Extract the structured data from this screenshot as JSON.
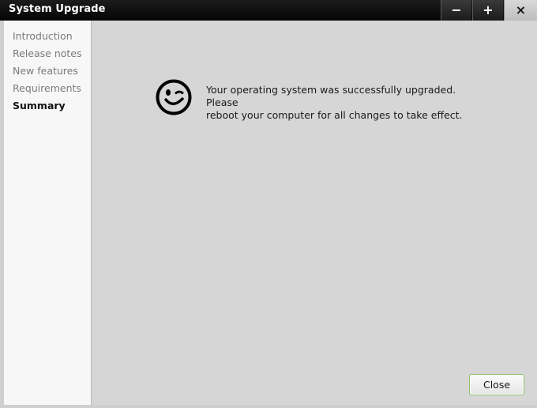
{
  "window": {
    "title": "System Upgrade",
    "minimize_label": "−",
    "maximize_label": "+",
    "close_label": "×"
  },
  "sidebar": {
    "items": [
      {
        "label": "Introduction",
        "active": false
      },
      {
        "label": "Release notes",
        "active": false
      },
      {
        "label": "New features",
        "active": false
      },
      {
        "label": "Requirements",
        "active": false
      },
      {
        "label": "Summary",
        "active": true
      }
    ]
  },
  "main": {
    "icon": "winking-smiley-icon",
    "message_line1": "Your operating system was successfully upgraded. Please",
    "message_line2": "reboot your computer for all changes to take effect.",
    "close_button_label": "Close"
  },
  "colors": {
    "titlebar": "#0d0d0d",
    "sidebar_bg": "#f7f7f7",
    "content_bg": "#d6d6d6",
    "accent_border": "#8fbf6a"
  }
}
